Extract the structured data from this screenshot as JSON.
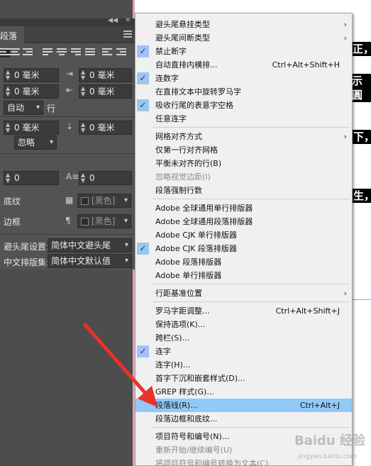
{
  "panel": {
    "tab_title": "段落",
    "fields": {
      "left_indent": "0 毫米",
      "right_indent": "0 毫米",
      "first_line_indent": "0 毫米",
      "last_line_indent": "0 毫米",
      "leading_value": "自动",
      "leading_unit": "行",
      "space_before": "0 毫米",
      "space_after": "0 毫米",
      "align_grid": "忽略",
      "drop_cap_lines": "0",
      "drop_cap_chars": "0"
    },
    "shading_label": "底纹",
    "shading_color": "[黑色]",
    "border_label": "边框",
    "border_color": "[黑色]",
    "kinsoku_label": "避头尾设置:",
    "kinsoku_value": "简体中文避头尾",
    "mojikumi_label": "中文排版集:",
    "mojikumi_value": "简体中文默认值"
  },
  "document": {
    "snippets": [
      "正，",
      "示圓",
      "下，",
      "生，"
    ]
  },
  "menu": {
    "items": [
      {
        "label": "避头尾悬挂类型",
        "submenu": true
      },
      {
        "label": "避头尾间断类型",
        "submenu": true
      },
      {
        "label": "禁止断字",
        "checked": true
      },
      {
        "label": "自动直排内横排...",
        "shortcut": "Ctrl+Alt+Shift+H"
      },
      {
        "label": "连数字",
        "checked": true
      },
      {
        "label": "在直排文本中旋转罗马字"
      },
      {
        "label": "吸收行尾的表意字空格",
        "checked": true
      },
      {
        "label": "任意连字"
      },
      {
        "label": "网格对齐方式",
        "submenu": true
      },
      {
        "label": "仅第一行对齐网格"
      },
      {
        "label": "平衡未对齐的行(B)"
      },
      {
        "label": "忽略视觉边距(I)",
        "disabled": true
      },
      {
        "label": "段落强制行数"
      },
      {
        "label": "Adobe 全球通用单行排版器"
      },
      {
        "label": "Adobe 全球通用段落排版器"
      },
      {
        "label": "Adobe CJK 单行排版器"
      },
      {
        "label": "Adobe CJK 段落排版器",
        "checked": true
      },
      {
        "label": "Adobe 段落排版器"
      },
      {
        "label": "Adobe 单行排版器"
      },
      {
        "label": "行距基准位置",
        "submenu": true
      },
      {
        "label": "罗马字距调整...",
        "shortcut": "Ctrl+Alt+Shift+J"
      },
      {
        "label": "保持选项(K)..."
      },
      {
        "label": "跨栏(S)..."
      },
      {
        "label": "连字",
        "checked": true
      },
      {
        "label": "连字(H)..."
      },
      {
        "label": "首字下沉和嵌套样式(D)..."
      },
      {
        "label": "GREP 样式(G)..."
      },
      {
        "label": "段落线(R)...",
        "shortcut": "Ctrl+Alt+J",
        "highlighted": true
      },
      {
        "label": "段落边框和底纹..."
      },
      {
        "label": "项目符号和编号(N)..."
      },
      {
        "label": "重新开始/继续编号(U)",
        "disabled": true
      },
      {
        "label": "将项目符号和编号转换为文本(C)",
        "disabled": true
      }
    ]
  },
  "colors": {
    "menu_bg": "#f0f0f0",
    "highlight": "#91c9f7",
    "check_bg": "#9dc5f0",
    "panel_bg": "#535353",
    "arrow": "#e8322b"
  },
  "watermark": {
    "text": "Baidu 经验",
    "sub": "jingyan.baidu.com"
  }
}
